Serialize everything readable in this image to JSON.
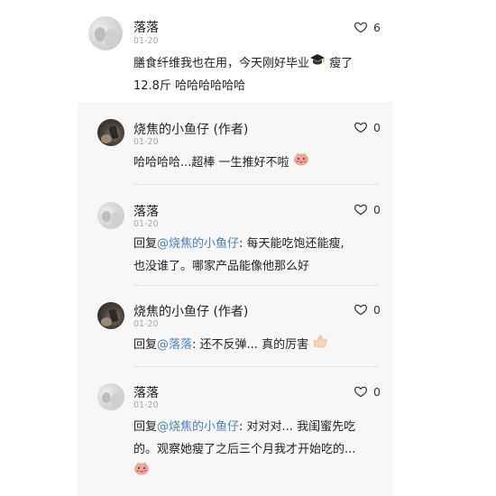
{
  "comment": {
    "user": "落落",
    "date": "01-20",
    "text_line1": "膳食纤维我也在用，今天刚好毕业",
    "text_line1b": " 瘦了",
    "text_line2": "12.8斤    哈哈哈哈哈哈",
    "likes": "6"
  },
  "replies": [
    {
      "user": "烧焦的小鱼仔 (作者)",
      "date": "01-20",
      "text": "哈哈哈哈...超棒  一生推好不啦",
      "likes": "0"
    },
    {
      "user": "落落",
      "date": "01-20",
      "reply_prefix": "回复",
      "mention": "@烧焦的小鱼仔",
      "line1_rest": ": 每天能吃饱还能瘦,",
      "line2": "也没谁了。哪家产品能像他那么好",
      "likes": "0"
    },
    {
      "user": "烧焦的小鱼仔 (作者)",
      "date": "01-20",
      "reply_prefix": "回复",
      "mention": "@落落",
      "line1_rest": ": 还不反弹...   真的厉害",
      "likes": "0"
    },
    {
      "user": "落落",
      "date": "01-20",
      "reply_prefix": "回复",
      "mention": "@烧焦的小鱼仔",
      "line1_rest": ": 对对对...   我闺蜜先吃",
      "line2": "的。观察她瘦了之后三个月我才开始吃的...",
      "likes": "0"
    }
  ],
  "icons": {
    "like": "heart-outline-icon",
    "graduation": "graduation-cap-icon",
    "smile": "blushing-emoji-icon",
    "thumbs": "thumbs-up-icon"
  }
}
